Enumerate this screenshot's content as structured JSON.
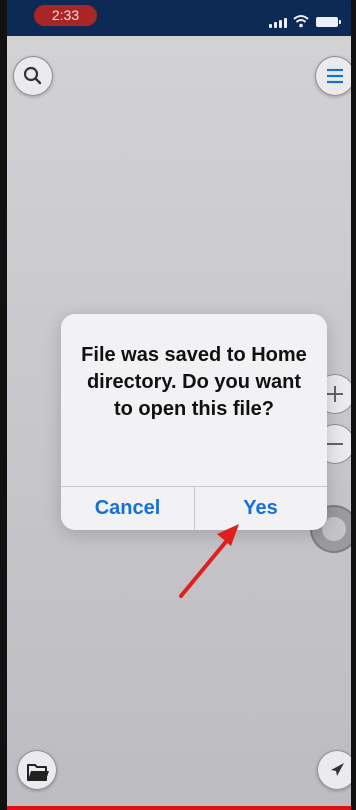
{
  "status_bar": {
    "time": "2:33"
  },
  "dialog": {
    "message": "File was saved to Home directory. Do you want to open this file?",
    "cancel_label": "Cancel",
    "yes_label": "Yes"
  },
  "colors": {
    "accent": "#1670d6",
    "annotation_arrow": "#e02020",
    "status_bar": "#0d2a55",
    "recording_pill": "#a92626"
  },
  "icons": {
    "top_left": "search-icon",
    "top_right": "menu-icon",
    "zoom_in": "plus-icon",
    "zoom_out": "minus-icon",
    "bottom_left": "folder-icon",
    "bottom_right": "location-arrow-icon"
  }
}
